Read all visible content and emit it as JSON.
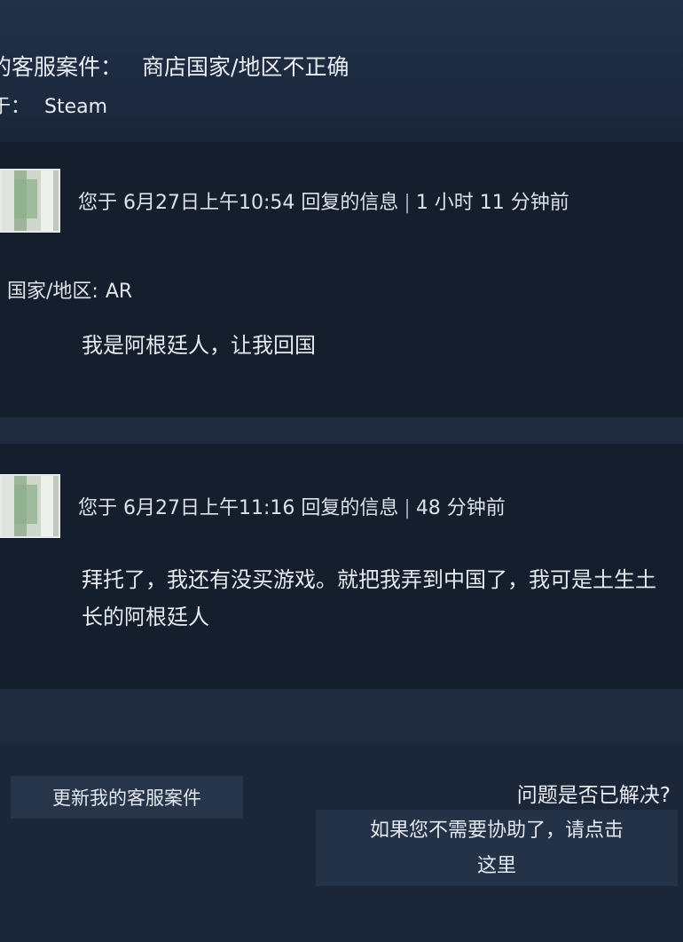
{
  "case": {
    "title_label": "的客服案件：",
    "title_value": "商店国家/地区不正确",
    "about_label": "于：",
    "about_value": "Steam"
  },
  "messages": [
    {
      "meta_left": "您于 6月27日上午10:54 回复的信息",
      "meta_right": "1 小时 11 分钟前",
      "region_label": "国家/地区:",
      "region_value": "AR",
      "text": "我是阿根廷人，让我回国"
    },
    {
      "meta_left": "您于 6月27日上午11:16 回复的信息",
      "meta_right": "48 分钟前",
      "text": "拜托了，我还有没买游戏。就把我弄到中国了，我可是土生土长的阿根廷人"
    }
  ],
  "actions": {
    "update_case": "更新我的客服案件",
    "resolved_question": "问题是否已解决?",
    "resolve_line1": "如果您不需要协助了，请点击",
    "resolve_line2": "这里"
  },
  "colors": {
    "background": "#1b2638",
    "message_block": "#151e2c",
    "button": "#27354b",
    "text": "#dfe3ea"
  }
}
